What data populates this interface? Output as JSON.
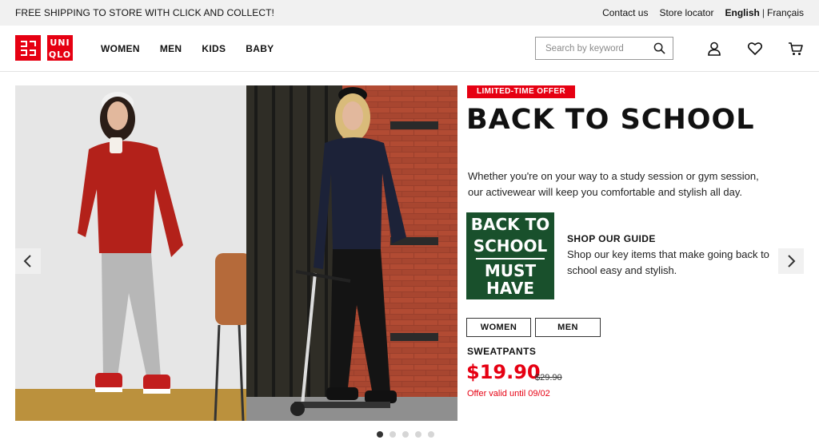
{
  "topbar": {
    "promo": "FREE SHIPPING TO STORE WITH CLICK AND COLLECT!",
    "contact": "Contact us",
    "store_locator": "Store locator",
    "lang_active": "English",
    "lang_separator": "|",
    "lang_other": "Français"
  },
  "header": {
    "logo_top": [
      "UNI",
      "QLO"
    ],
    "nav": [
      "WOMEN",
      "MEN",
      "KIDS",
      "BABY"
    ],
    "search_placeholder": "Search by keyword",
    "icons": [
      "search-icon",
      "account-icon",
      "wishlist-heart-icon",
      "cart-icon"
    ]
  },
  "hero": {
    "badge": "LIMITED-TIME OFFER",
    "headline": "BACK TO SCHOOL",
    "description": "Whether you're on your way to a study session or gym session, our activewear will keep you comfortable and stylish all day.",
    "guide_image": {
      "line1": "BACK TO",
      "line2": "SCHOOL",
      "line3": "MUST",
      "line4": "HAVE"
    },
    "guide_title": "SHOP OUR GUIDE",
    "guide_text": "Shop our key items that make going back to school easy and stylish.",
    "buttons": [
      "WOMEN",
      "MEN"
    ],
    "product_name": "SWEATPANTS",
    "price": "$19.90",
    "old_price": "$29.90",
    "offer": "Offer valid until 09/02"
  },
  "carousel": {
    "slides": 5,
    "active_index": 0
  },
  "colors": {
    "brand_red": "#e60012",
    "guide_green": "#19502c"
  }
}
